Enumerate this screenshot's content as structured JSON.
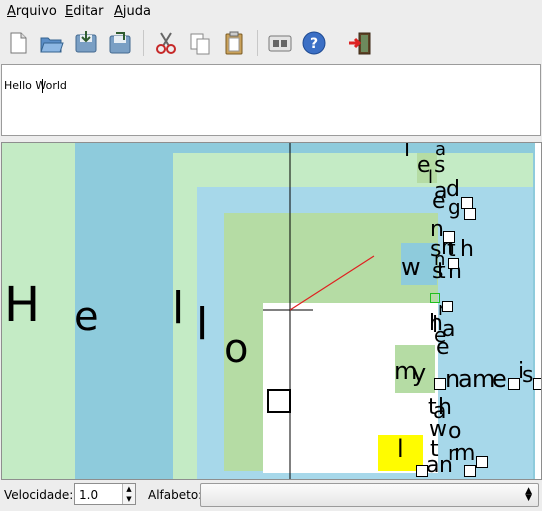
{
  "menubar": {
    "items": [
      {
        "mnemonic": "A",
        "rest": "rquivo"
      },
      {
        "mnemonic": "E",
        "rest": "ditar"
      },
      {
        "mnemonic": "A",
        "rest": "juda"
      }
    ]
  },
  "toolbar": {
    "icons": [
      "new-file-icon",
      "open-folder-icon",
      "save-icon",
      "save-as-icon",
      "cut-icon",
      "copy-icon",
      "paste-icon",
      "preferences-icon",
      "help-icon",
      "quit-icon"
    ]
  },
  "editor": {
    "text": "Hello  World"
  },
  "canvas": {
    "colors": {
      "green": "#c4ebc5",
      "blue": "#8ecbdc",
      "lightblue": "#a7d8ea",
      "midgreen": "#b5dca4",
      "yellow": "#fffc00",
      "crosshair": "#000000",
      "pointer": "#e02020"
    },
    "big_letters": [
      "H",
      "e",
      "l",
      "l",
      "o"
    ],
    "right_glyphs": [
      "l",
      "a",
      "e",
      "s",
      "l",
      "a",
      "d",
      "e",
      "n",
      "g",
      "n",
      "s",
      "n",
      "t",
      "h",
      "w",
      "s",
      "t",
      "h",
      "r",
      "e",
      "l",
      "h",
      "a",
      "e",
      "m",
      "y",
      "n",
      "a",
      "m",
      "e",
      "i",
      "s",
      "t",
      "h",
      "a",
      "w",
      "o",
      "t",
      "l",
      "r",
      "m",
      "a",
      "n"
    ]
  },
  "status": {
    "speed_label": "Velocidade:",
    "speed_value": "1.0",
    "alphabet_label": "Alfabeto:",
    "alphabet_value": ""
  }
}
